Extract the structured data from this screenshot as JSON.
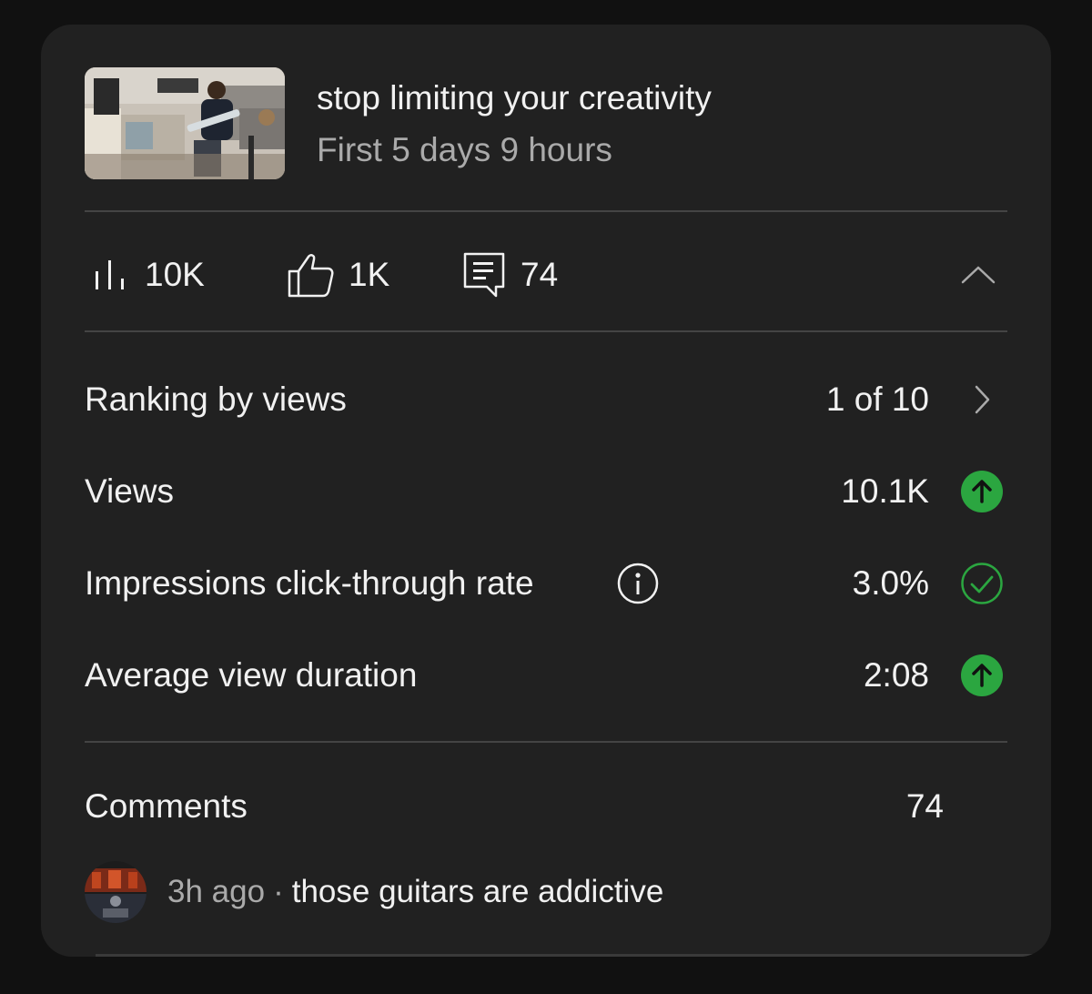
{
  "video": {
    "title": "stop limiting your creativity",
    "subtitle": "First 5 days 9 hours"
  },
  "stats": {
    "views": {
      "icon": "bar-chart-icon",
      "value": "10K"
    },
    "likes": {
      "icon": "thumbs-up-icon",
      "value": "1K"
    },
    "comments": {
      "icon": "comment-icon",
      "value": "74"
    },
    "collapse_icon": "chevron-up-icon"
  },
  "metrics": [
    {
      "label": "Ranking by views",
      "value": "1 of 10",
      "trail_icon": "chevron-right-icon"
    },
    {
      "label": "Views",
      "value": "10.1K",
      "trail_icon": "arrow-up-circle-icon"
    },
    {
      "label": "Impressions click-through rate",
      "value": "3.0%",
      "trail_icon": "check-circle-icon",
      "info_icon": "info-icon"
    },
    {
      "label": "Average view duration",
      "value": "2:08",
      "trail_icon": "arrow-up-circle-icon"
    }
  ],
  "comments": {
    "label": "Comments",
    "count": "74",
    "latest": {
      "time": "3h ago",
      "separator": "·",
      "text": "those guitars are addictive"
    }
  },
  "colors": {
    "background": "#111111",
    "card": "#212121",
    "text_primary": "#f1f1f1",
    "text_secondary": "#aaaaaa",
    "success_green": "#2ba640",
    "divider": "#444444"
  }
}
